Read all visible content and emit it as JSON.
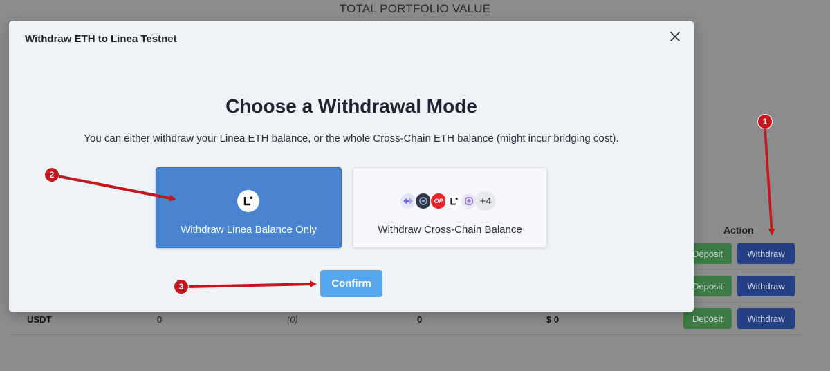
{
  "background": {
    "portfolio_title": "TOTAL PORTFOLIO VALUE",
    "action_header": "Action",
    "rows": [
      {
        "deposit_label": "Deposit",
        "withdraw_label": "Withdraw"
      },
      {
        "deposit_label": "Deposit",
        "withdraw_label": "Withdraw"
      },
      {
        "token": "USDT",
        "balance": "0",
        "value_paren": "(0)",
        "amount": "0",
        "usd": "$ 0",
        "deposit_label": "Deposit",
        "withdraw_label": "Withdraw"
      }
    ]
  },
  "modal": {
    "title": "Withdraw ETH to Linea Testnet",
    "close_icon": "close-icon",
    "heading": "Choose a Withdrawal Mode",
    "description": "You can either withdraw your Linea ETH balance, or the whole Cross-Chain ETH balance (might incur bridging cost).",
    "options": [
      {
        "label": "Withdraw Linea Balance Only",
        "icon": "linea-logo-icon",
        "selected": true
      },
      {
        "label": "Withdraw Cross-Chain Balance",
        "icons": [
          "arbitrum-icon",
          "scroll-icon",
          "optimism-icon",
          "linea-icon",
          "zksync-icon"
        ],
        "more_count": "+4",
        "selected": false
      }
    ],
    "optimism_badge": "OP",
    "confirm_label": "Confirm"
  },
  "annotations": {
    "step_1": "1",
    "step_2": "2",
    "step_3": "3",
    "arrow_color": "#c4161c"
  }
}
